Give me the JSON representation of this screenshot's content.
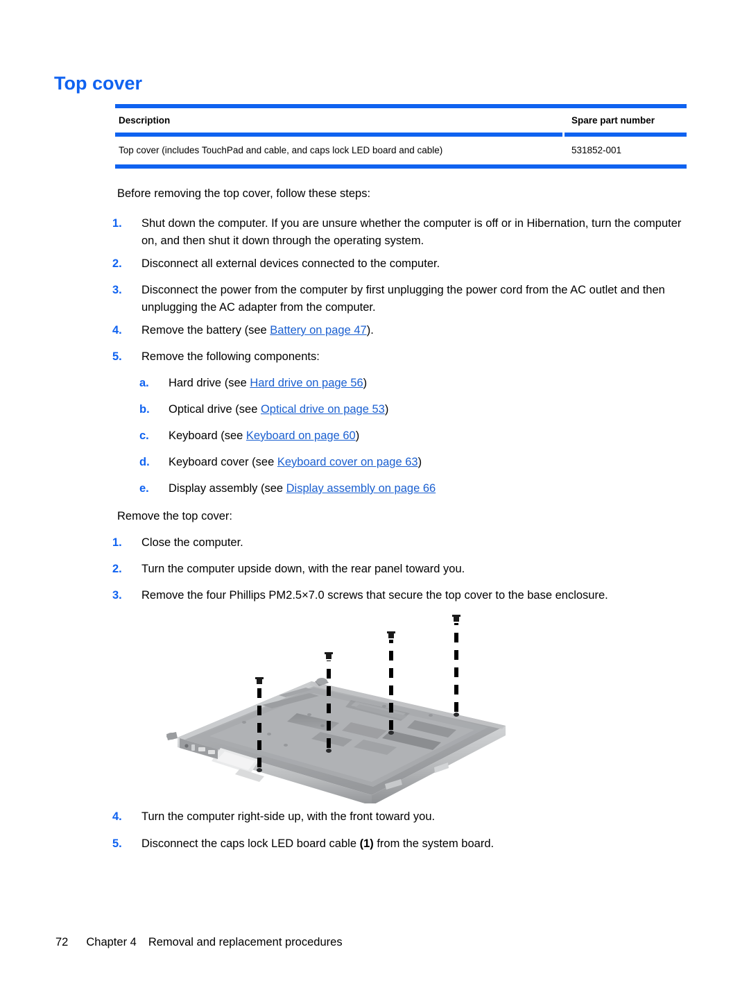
{
  "title": "Top cover",
  "table": {
    "headers": {
      "description": "Description",
      "spare_part_number": "Spare part number"
    },
    "rows": [
      {
        "description": "Top cover (includes TouchPad and cable, and caps lock LED board and cable)",
        "spare_part_number": "531852-001"
      }
    ]
  },
  "intro_before": "Before removing the top cover, follow these steps:",
  "before_steps": [
    {
      "marker": "1.",
      "text": "Shut down the computer. If you are unsure whether the computer is off or in Hibernation, turn the computer on, and then shut it down through the operating system."
    },
    {
      "marker": "2.",
      "text": "Disconnect all external devices connected to the computer."
    },
    {
      "marker": "3.",
      "text": "Disconnect the power from the computer by first unplugging the power cord from the AC outlet and then unplugging the AC adapter from the computer."
    },
    {
      "marker": "4.",
      "text_before": "Remove the battery (see ",
      "link": "Battery on page 47",
      "text_after": ")."
    },
    {
      "marker": "5.",
      "text": "Remove the following components:"
    }
  ],
  "sub_steps": [
    {
      "marker": "a.",
      "text_before": "Hard drive (see ",
      "link": "Hard drive on page 56",
      "text_after": ")"
    },
    {
      "marker": "b.",
      "text_before": "Optical drive (see ",
      "link": "Optical drive on page 53",
      "text_after": ")"
    },
    {
      "marker": "c.",
      "text_before": "Keyboard (see ",
      "link": "Keyboard on page 60",
      "text_after": ")"
    },
    {
      "marker": "d.",
      "text_before": "Keyboard cover (see ",
      "link": "Keyboard cover on page 63",
      "text_after": ")"
    },
    {
      "marker": "e.",
      "text_before": "Display assembly (see ",
      "link": "Display assembly on page 66",
      "text_after": ""
    }
  ],
  "intro_remove": "Remove the top cover:",
  "remove_steps": [
    {
      "marker": "1.",
      "text": "Close the computer."
    },
    {
      "marker": "2.",
      "text": "Turn the computer upside down, with the rear panel toward you."
    },
    {
      "marker": "3.",
      "text": "Remove the four Phillips PM2.5×7.0 screws that secure the top cover to the base enclosure."
    },
    {
      "marker": "4.",
      "text": "Turn the computer right-side up, with the front toward you."
    },
    {
      "marker": "5.",
      "text_before": "Disconnect the caps lock LED board cable ",
      "bold": "(1)",
      "text_after": " from the system board."
    }
  ],
  "figure": {
    "alt": "Laptop base enclosure bottom view with four dashed screw callout lines",
    "callout_count": 4
  },
  "footer": {
    "page_number": "72",
    "chapter": "Chapter 4",
    "chapter_title": "Removal and replacement procedures"
  },
  "colors": {
    "accent_blue": "#0f62f0",
    "link_blue": "#1a5fd0",
    "text_black": "#000000"
  }
}
